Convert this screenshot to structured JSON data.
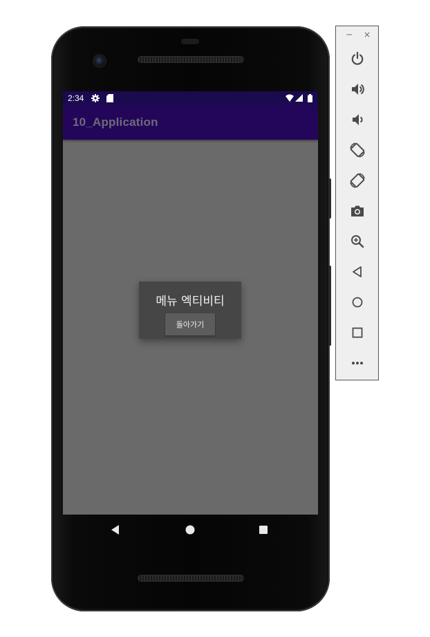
{
  "status_bar": {
    "time": "2:34",
    "icons": [
      "settings-gear-icon",
      "sd-card-icon",
      "wifi-icon",
      "cell-signal-icon",
      "battery-icon"
    ]
  },
  "app_bar": {
    "title": "10_Application"
  },
  "dialog": {
    "title": "메뉴 엑티비티",
    "button_label": "돌아가기"
  },
  "nav_bar": {
    "items": [
      "back-icon",
      "home-icon",
      "recents-icon"
    ]
  },
  "emulator_toolbar": {
    "window_controls": {
      "minimize": "−",
      "close": "×"
    },
    "buttons": [
      "power-icon",
      "volume-up-icon",
      "volume-down-icon",
      "rotate-left-icon",
      "rotate-right-icon",
      "screenshot-camera-icon",
      "zoom-icon",
      "back-icon",
      "home-icon",
      "overview-icon",
      "more-options-icon"
    ]
  },
  "colors": {
    "status_bar": "#1a0a4f",
    "app_bar": "#23065a",
    "screen_background": "#6a6a6a",
    "dialog_background": "#464646",
    "dialog_button": "#5c5c5c",
    "toolbar_background": "#efefef",
    "toolbar_icon": "#4a4a4a"
  }
}
